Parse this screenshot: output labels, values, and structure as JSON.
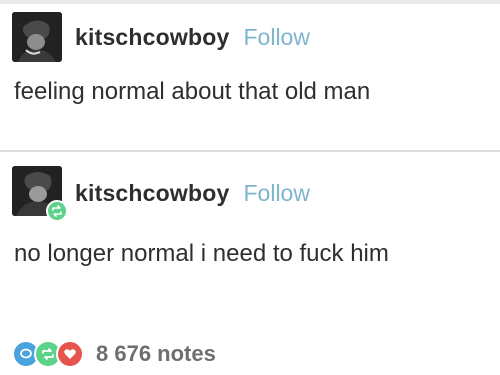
{
  "posts": [
    {
      "username": "kitschcowboy",
      "follow_label": "Follow",
      "text": "feeling normal about that old man",
      "avatar_icon": "avatar-photo",
      "reblogged": false
    },
    {
      "username": "kitschcowboy",
      "follow_label": "Follow",
      "text": "no longer normal i need to fuck him",
      "avatar_icon": "avatar-photo",
      "reblogged": true,
      "badge_icon": "reblog-icon"
    }
  ],
  "notes": {
    "count_label": "8 676 notes",
    "icons": [
      "reply-icon",
      "reblog-icon",
      "heart-icon"
    ]
  },
  "colors": {
    "follow": "#7fb4cf",
    "reblog_green": "#5cd28b",
    "reply_blue": "#4aa3df",
    "like_red": "#e7534d"
  }
}
